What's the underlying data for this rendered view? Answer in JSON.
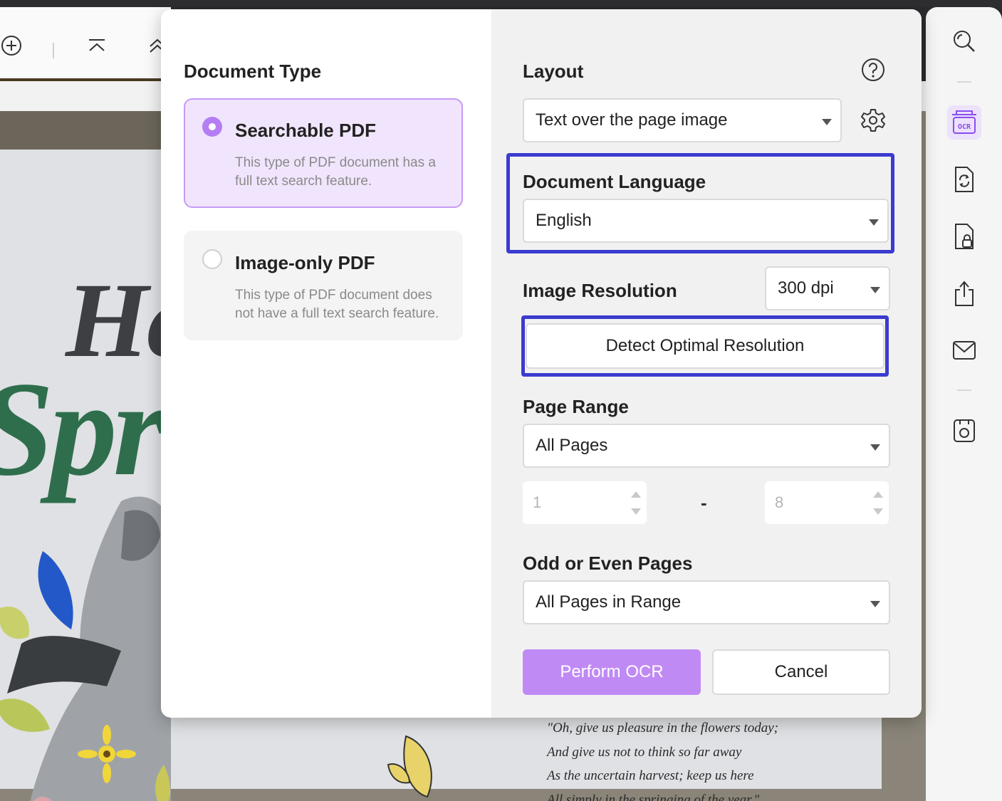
{
  "dialog": {
    "document_type": {
      "title": "Document Type",
      "options": [
        {
          "label": "Searchable PDF",
          "description": "This type of PDF document has a full text search feature.",
          "selected": true
        },
        {
          "label": "Image-only PDF",
          "description": "This type of PDF document does not have a full text search feature.",
          "selected": false
        }
      ]
    },
    "layout": {
      "title": "Layout",
      "value": "Text over the page image"
    },
    "language": {
      "title": "Document Language",
      "value": "English"
    },
    "resolution": {
      "title": "Image Resolution",
      "value": "300 dpi",
      "detect_label": "Detect Optimal Resolution"
    },
    "page_range": {
      "title": "Page Range",
      "value": "All Pages",
      "from": "1",
      "separator": "-",
      "to": "8"
    },
    "odd_even": {
      "title": "Odd or Even Pages",
      "value": "All Pages in Range"
    },
    "buttons": {
      "perform": "Perform OCR",
      "cancel": "Cancel"
    }
  },
  "background_document": {
    "headline_fragment_1": "He",
    "headline_fragment_2": "Spr",
    "poem_lines": [
      "\"Oh, give us pleasure in the flowers today;",
      "And give us not to think so far away",
      "As the uncertain harvest; keep us here",
      "All simply in the springing of the year.\""
    ]
  },
  "sidebar": {
    "items": [
      "search-icon",
      "ocr-icon",
      "convert-icon",
      "protect-icon",
      "share-icon",
      "mail-icon",
      "save-icon"
    ],
    "ocr_label": "OCR",
    "active": "ocr-icon"
  },
  "colors": {
    "accent": "#b57ef5",
    "primary_button": "#c08af5",
    "highlight_box": "#3b3bd0",
    "selected_card_bg": "#f1e5fd"
  }
}
